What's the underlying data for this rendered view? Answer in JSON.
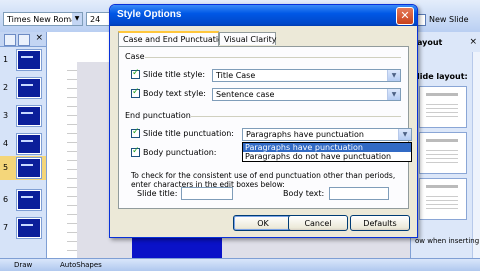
{
  "toolbar": {
    "font_name": "Times New Roman",
    "font_size": "24",
    "new_slide_label": "New Slide"
  },
  "slides_pane": {
    "numbers": [
      "1",
      "2",
      "3",
      "4",
      "5",
      "6",
      "7"
    ]
  },
  "layout_pane": {
    "title": "ayout",
    "subtitle": "lide layout:",
    "note": "ow when inserting ne"
  },
  "status_bar": {
    "draw_label": "Draw",
    "autoshapes_label": "AutoShapes"
  },
  "dialog": {
    "title": "Style Options",
    "tabs": [
      {
        "label": "Case and End Punctuation",
        "active": true
      },
      {
        "label": "Visual Clarity",
        "active": false
      }
    ],
    "case_section_label": "Case",
    "slide_title_style_label": "Slide title style:",
    "slide_title_style_value": "Title Case",
    "body_text_style_label": "Body text style:",
    "body_text_style_value": "Sentence case",
    "end_punct_section_label": "End punctuation",
    "slide_title_punct_label": "Slide title punctuation:",
    "slide_title_punct_value": "Paragraphs have punctuation",
    "punct_options": [
      "Paragraphs have punctuation",
      "Paragraphs do not have punctuation"
    ],
    "body_punct_label": "Body punctuation:",
    "help_text": "To check for the consistent use of end punctuation other than periods, enter characters in the edit boxes below:",
    "slide_title_field_label": "Slide title:",
    "body_text_field_label": "Body text:",
    "ok_label": "OK",
    "cancel_label": "Cancel",
    "defaults_label": "Defaults"
  }
}
